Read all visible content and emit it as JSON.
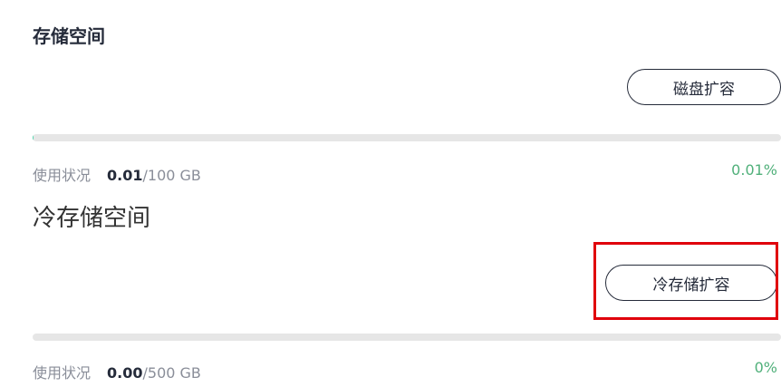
{
  "storage": {
    "title": "存储空间",
    "expand_button_label": "磁盘扩容",
    "usage_label": "使用状况",
    "used": "0.01",
    "total": "/100 GB",
    "percent_text": "0.01%",
    "percent_value": 0.01
  },
  "cold_storage": {
    "title": "冷存储空间",
    "expand_button_label": "冷存储扩容",
    "usage_label": "使用状况",
    "used": "0.00",
    "total": "/500 GB",
    "percent_text": "0%",
    "percent_value": 0
  },
  "colors": {
    "progress_fill": "#50d4ab",
    "progress_track": "#e6e6e6",
    "percent_text": "#50b07a",
    "highlight_border": "#e0000b"
  }
}
